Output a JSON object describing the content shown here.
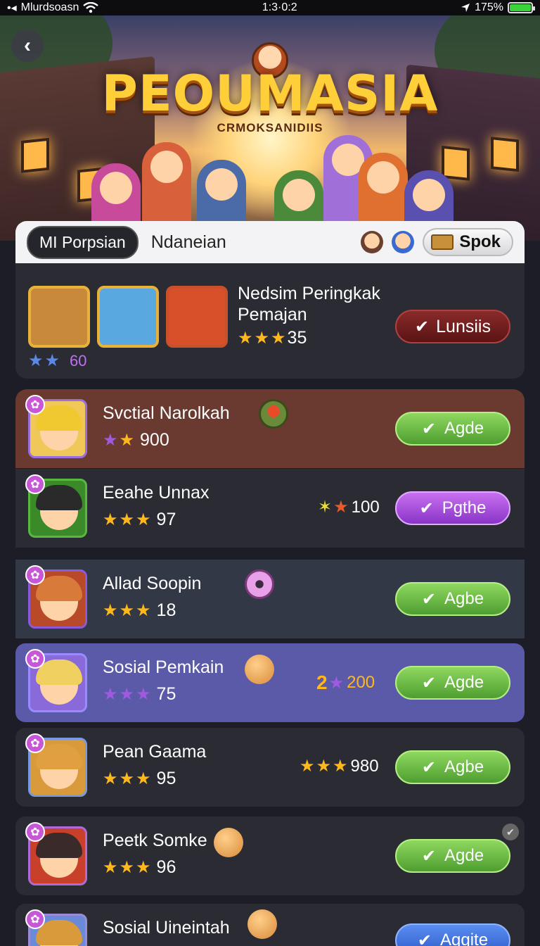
{
  "status_bar": {
    "carrier": "Mlurdsoasn",
    "time": "1:3·0:2",
    "battery": "175%",
    "battery_level": 1.0
  },
  "hero": {
    "game_title": "PEOUMASIA",
    "subtitle": "CRMOKSANIDIIS",
    "back_icon": "chevron-left-icon"
  },
  "header": {
    "active_tab": "MI Porpsian",
    "inactive_tab": "Ndaneian",
    "action_label": "Spok",
    "action_icon": "box-icon"
  },
  "featured": {
    "title": "Nedsim Peringkak Pemajan",
    "stars": 3,
    "score": "35",
    "sub_stars": 2,
    "sub_value": "60",
    "button_label": "Lunsiis"
  },
  "rows": [
    {
      "name": "Svctial Narolkah",
      "rating": "900",
      "stars": [
        "purple",
        "gold"
      ],
      "button": "Agde",
      "button_style": "green",
      "icon": "jar-icon",
      "bg": "#6a3a30"
    },
    {
      "name": "Eeahe Unnax",
      "rating": "97",
      "stars": [
        "gold",
        "gold",
        "gold"
      ],
      "button": "Pgthe",
      "button_style": "purple",
      "icon": "",
      "score": "100",
      "bg": "#2a2b33"
    },
    {
      "name": "Allad Soopin",
      "rating": "18",
      "stars": [
        "gold",
        "gold",
        "gold"
      ],
      "button": "Agbe",
      "button_style": "green",
      "icon": "robot-face-icon",
      "bg": "#333846"
    },
    {
      "name": "Sosial Pemkain",
      "rating": "75",
      "stars": [
        "purple",
        "purple",
        "purple"
      ],
      "button": "Agde",
      "button_style": "green",
      "icon": "smiley-face-icon",
      "score_prefix": "2",
      "score": "200",
      "bg": "#5a5aa8"
    },
    {
      "name": "Pean Gaama",
      "rating": "95",
      "stars": [
        "gold",
        "gold",
        "gold"
      ],
      "button": "Agbe",
      "button_style": "green",
      "icon": "",
      "score": "980",
      "bg": "#2a2b33"
    },
    {
      "name": "Peetk Somke",
      "rating": "96",
      "stars": [
        "gold",
        "gold",
        "gold"
      ],
      "button": "Agde",
      "button_style": "green",
      "icon": "smiley-face-icon",
      "bg": "#2a2b33"
    },
    {
      "name": "Sosial Uineintah",
      "rating": "",
      "stars": [
        "gold",
        "gold",
        "gold"
      ],
      "button": "Aggite",
      "button_style": "blue",
      "icon": "smiley-face-icon",
      "bg": "#2a2b33"
    }
  ]
}
